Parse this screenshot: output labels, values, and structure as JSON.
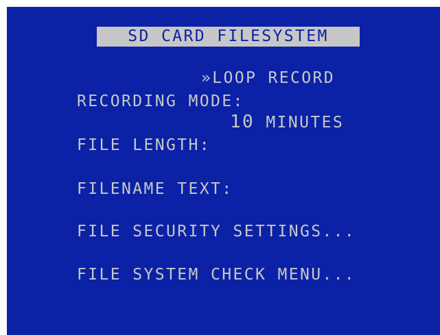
{
  "menu": {
    "title": "SD CARD FILESYSTEM",
    "items": [
      {
        "label": "RECORDING MODE:",
        "value": "»LOOP RECORD"
      },
      {
        "label": "FILE LENGTH:",
        "value_number": "10",
        "value_unit": " MINUTES"
      },
      {
        "label": "FILENAME TEXT:"
      },
      {
        "label": "FILE SECURITY SETTINGS..."
      },
      {
        "label": "FILE SYSTEM CHECK MENU..."
      }
    ]
  },
  "colors": {
    "background": "#0b22a6",
    "text": "#c8c8c8",
    "title_highlight": "#c7c7c7"
  }
}
